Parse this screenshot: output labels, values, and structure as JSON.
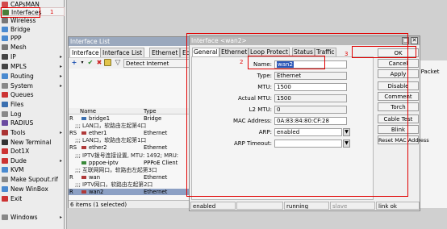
{
  "sidebar": {
    "items": [
      {
        "label": "CAPsMAN",
        "color": "#d24a4a",
        "arrow": ""
      },
      {
        "label": "Interfaces",
        "color": "#4a7f3a",
        "arrow": ""
      },
      {
        "label": "Wireless",
        "color": "#777777",
        "arrow": ""
      },
      {
        "label": "Bridge",
        "color": "#4a8ad0",
        "arrow": ""
      },
      {
        "label": "PPP",
        "color": "#4a8ad0",
        "arrow": ""
      },
      {
        "label": "Mesh",
        "color": "#777777",
        "arrow": ""
      },
      {
        "label": "IP",
        "color": "#444444",
        "arrow": "▸"
      },
      {
        "label": "MPLS",
        "color": "#444444",
        "arrow": "▸"
      },
      {
        "label": "Routing",
        "color": "#4a8ad0",
        "arrow": "▸"
      },
      {
        "label": "System",
        "color": "#888888",
        "arrow": "▸"
      },
      {
        "label": "Queues",
        "color": "#cc3333",
        "arrow": ""
      },
      {
        "label": "Files",
        "color": "#3a6fb0",
        "arrow": ""
      },
      {
        "label": "Log",
        "color": "#888888",
        "arrow": ""
      },
      {
        "label": "RADIUS",
        "color": "#6a4aa0",
        "arrow": ""
      },
      {
        "label": "Tools",
        "color": "#aa3333",
        "arrow": "▸"
      },
      {
        "label": "New Terminal",
        "color": "#333333",
        "arrow": ""
      },
      {
        "label": "Dot1X",
        "color": "#cc3333",
        "arrow": ""
      },
      {
        "label": "Dude",
        "color": "#cc3333",
        "arrow": "▸"
      },
      {
        "label": "KVM",
        "color": "#4a8ad0",
        "arrow": ""
      },
      {
        "label": "Make Supout.rif",
        "color": "#888888",
        "arrow": ""
      },
      {
        "label": "New WinBox",
        "color": "#4a8ad0",
        "arrow": ""
      },
      {
        "label": "Exit",
        "color": "#cc3333",
        "arrow": ""
      },
      {
        "label": "Windows",
        "color": "#888888",
        "arrow": "▸"
      }
    ],
    "annotation": "1"
  },
  "list_window": {
    "title": "Interface List",
    "tabs": [
      "Interface",
      "Interface List",
      "Ethernet",
      "EoI"
    ],
    "detect_label": "Detect Internet",
    "col_name": "Name",
    "col_type": "Type",
    "rows": [
      {
        "flag": "R",
        "name": "bridge1",
        "type": "Bridge",
        "comment": false
      },
      {
        "flag": "",
        "name": ";;; LAN口，软路由左起第4口",
        "type": "",
        "comment": true
      },
      {
        "flag": "RS",
        "name": "ether1",
        "type": "Ethernet",
        "comment": false
      },
      {
        "flag": "",
        "name": ";;; LAN口，软路由左起第1口",
        "type": "",
        "comment": true
      },
      {
        "flag": "RS",
        "name": "ether2",
        "type": "Ethernet",
        "comment": false
      },
      {
        "flag": "",
        "name": ";;; IPTV拨号连接设置, MTU: 1492; MRU:",
        "type": "",
        "comment": true
      },
      {
        "flag": "",
        "name": "pppoe-iptv",
        "type": "PPPoE Client",
        "comment": false
      },
      {
        "flag": "",
        "name": ";;; 互联网网口，软路由左起第3口",
        "type": "",
        "comment": true
      },
      {
        "flag": "R",
        "name": "wan",
        "type": "Ethernet",
        "comment": false
      },
      {
        "flag": "",
        "name": ";;; IPTV网口，软路由左起第2口",
        "type": "",
        "comment": true
      },
      {
        "flag": "R",
        "name": "wan2",
        "type": "Ethernet",
        "comment": false
      }
    ],
    "footer": "6 items (1 selected)",
    "right_header": "Tx Packet"
  },
  "dialog": {
    "title": "Interface <wan2>",
    "tabs": [
      "General",
      "Ethernet",
      "Loop Protect",
      "Status",
      "Traffic"
    ],
    "fields": [
      {
        "label": "Name:",
        "value": "wan2"
      },
      {
        "label": "Type:",
        "value": "Ethernet"
      },
      {
        "label": "MTU:",
        "value": "1500"
      },
      {
        "label": "Actual MTU:",
        "value": "1500"
      },
      {
        "label": "L2 MTU:",
        "value": "0"
      },
      {
        "label": "MAC Address:",
        "value": "0A:83:84:80:CF:28"
      },
      {
        "label": "ARP:",
        "value": "enabled"
      },
      {
        "label": "ARP Timeout:",
        "value": ""
      }
    ],
    "buttons": [
      "OK",
      "Cancel",
      "Apply",
      "Disable",
      "Comment",
      "Torch",
      "Cable Test",
      "Blink",
      "Reset MAC Address"
    ],
    "status": [
      "enabled",
      "",
      "running",
      "slave",
      "link ok"
    ],
    "annotation_name": "2",
    "annotation_ok": "3"
  },
  "colors": {
    "selection": "#8ca0c4",
    "title_bar": "#9aa8bd",
    "highlight": "#e00000"
  }
}
